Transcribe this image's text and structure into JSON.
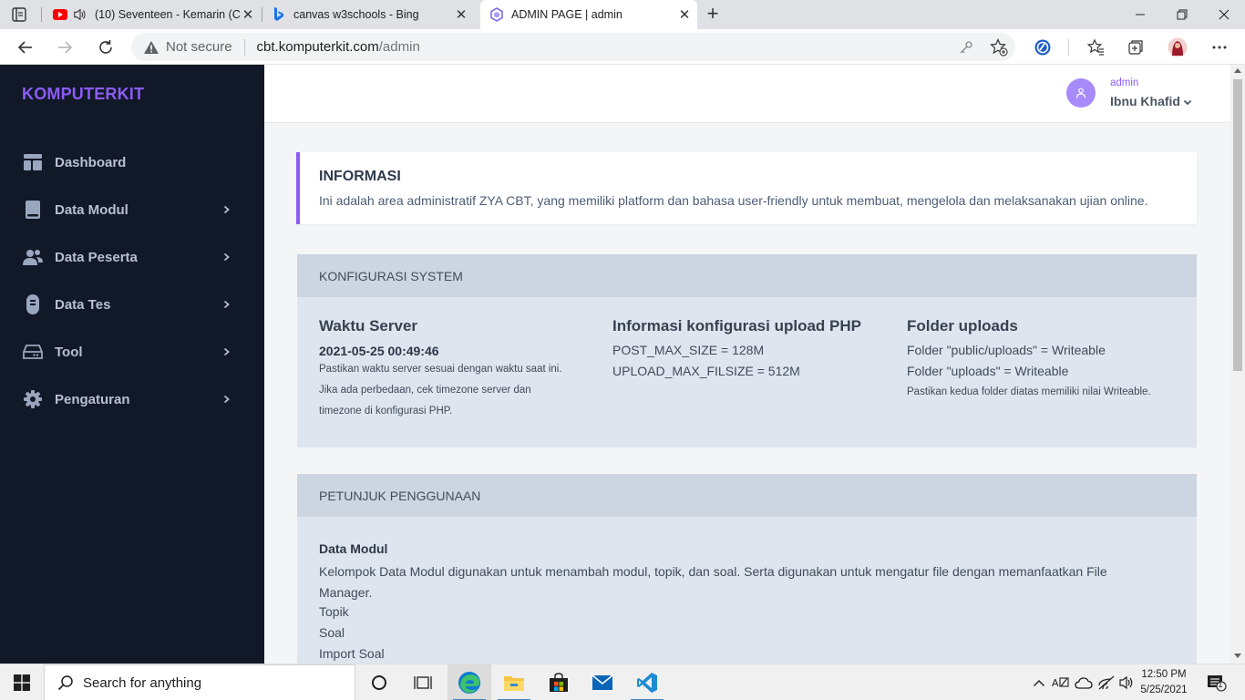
{
  "browser": {
    "tabs": [
      {
        "title": "(10) Seventeen - Kemarin (C",
        "icon": "youtube-icon",
        "audio": true
      },
      {
        "title": "canvas w3schools - Bing",
        "icon": "bing-icon"
      },
      {
        "title": "ADMIN PAGE | admin",
        "icon": "site-hexagon-icon",
        "active": true
      }
    ],
    "address": {
      "security_label": "Not secure",
      "host": "cbt.komputerkit.com",
      "path": "/admin"
    }
  },
  "sidebar": {
    "brand": "KOMPUTERKIT",
    "items": [
      {
        "label": "Dashboard",
        "icon": "dashboard-icon",
        "has_submenu": false
      },
      {
        "label": "Data Modul",
        "icon": "book-icon",
        "has_submenu": true
      },
      {
        "label": "Data Peserta",
        "icon": "users-icon",
        "has_submenu": true
      },
      {
        "label": "Data Tes",
        "icon": "capsule-icon",
        "has_submenu": true
      },
      {
        "label": "Tool",
        "icon": "drive-icon",
        "has_submenu": true
      },
      {
        "label": "Pengaturan",
        "icon": "gear-icon",
        "has_submenu": true
      }
    ]
  },
  "header": {
    "user_role": "admin",
    "user_name": "Ibnu Khafid"
  },
  "info": {
    "title": "INFORMASI",
    "text": "Ini adalah area administratif ZYA CBT, yang memiliki platform dan bahasa user-friendly untuk membuat, mengelola dan melaksanakan ujian online."
  },
  "config": {
    "heading": "KONFIGURASI SYSTEM",
    "server_time": {
      "title": "Waktu Server",
      "value": "2021-05-25 00:49:46",
      "note_1": "Pastikan waktu server sesuai dengan waktu saat ini.",
      "note_2": "Jika ada perbedaan, cek timezone server dan",
      "note_3": "timezone di konfigurasi PHP."
    },
    "php_upload": {
      "title": "Informasi konfigurasi upload PHP",
      "line_1": "POST_MAX_SIZE = 128M",
      "line_2": "UPLOAD_MAX_FILSIZE = 512M"
    },
    "folders": {
      "title": "Folder uploads",
      "line_1": "Folder \"public/uploads\" = Writeable",
      "line_2": "Folder \"uploads\" = Writeable",
      "note": "Pastikan kedua folder diatas memiliki nilai Writeable."
    }
  },
  "guide": {
    "heading": "PETUNJUK PENGGUNAAN",
    "section_title": "Data Modul",
    "section_text": "Kelompok Data Modul digunakan untuk menambah modul, topik, dan soal. Serta digunakan untuk mengatur file dengan memanfaatkan File Manager.",
    "items": [
      "Topik",
      "Soal",
      "Import Soal"
    ]
  },
  "taskbar": {
    "search_placeholder": "Search for anything",
    "time": "12:50 PM",
    "date": "5/25/2021",
    "notification_count": "1"
  },
  "colors": {
    "accent": "#8b5cf6",
    "sidebar_bg": "#111827",
    "card_bg": "#dfe5ee",
    "card_head_bg": "#cdd5e0"
  }
}
